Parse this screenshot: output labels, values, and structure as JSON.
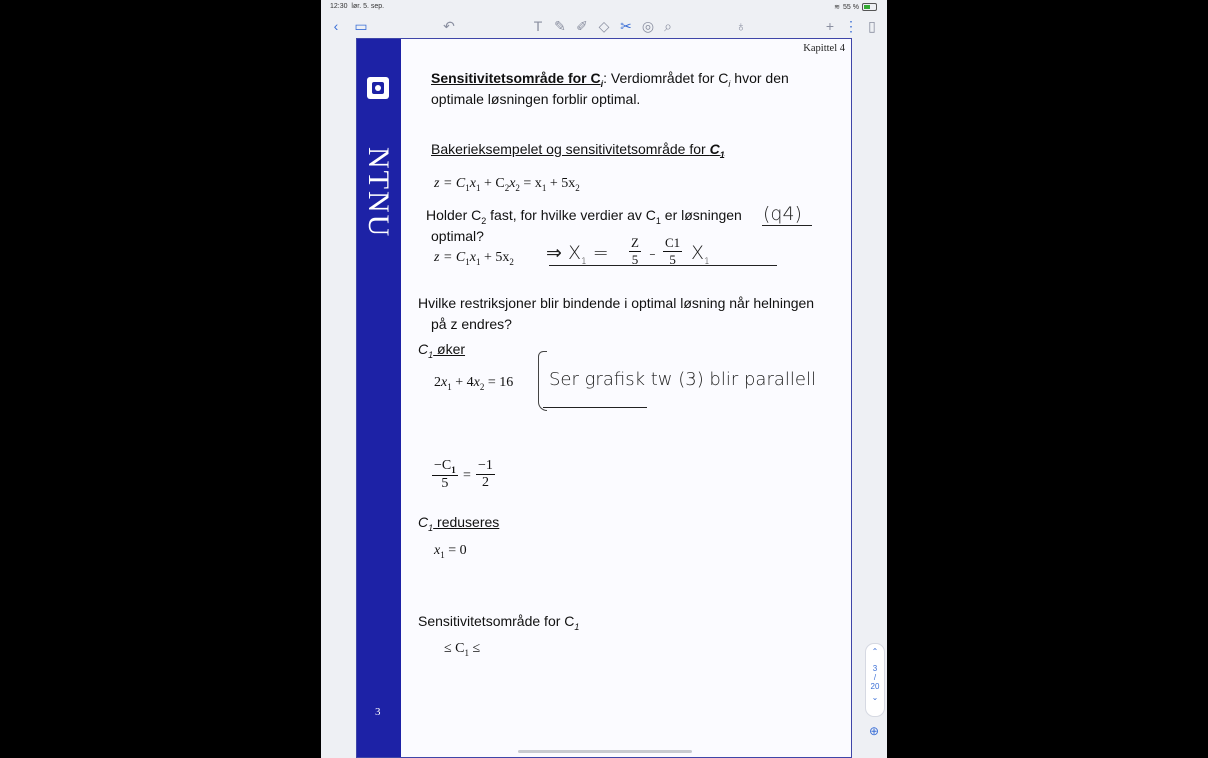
{
  "status": {
    "time": "12:30",
    "date": "lør. 5. sep.",
    "battery": "55 %"
  },
  "toolbar": {
    "icons": [
      "back-icon",
      "thumbnails-icon",
      "undo-icon",
      "text-tool-icon",
      "pen-icon",
      "highlighter-icon",
      "eraser-icon",
      "scissors-icon",
      "shapes-icon",
      "lasso-icon",
      "microphone-icon",
      "add-icon",
      "more-icon",
      "pages-icon"
    ],
    "accent": "#3b6fd6"
  },
  "page": {
    "chapter": "Kapittel 4",
    "number": "3",
    "logo_text": "NTNU",
    "heading1_bold": "Sensitivitetsområde for C",
    "heading1_sub": "i",
    "heading1_rest": ": Verdiområdet for C",
    "heading1_rest_sub": "i",
    "heading1_rest2": " hvor den",
    "heading1_line2": "optimale løsningen forblir optimal.",
    "heading2": "Bakerieksempelet og sensitivitetsområde for ",
    "heading2_bold": "C",
    "heading2_sub": "1",
    "eq1_a": "z = C",
    "eq1_b": "x",
    "eq1_c": " + C",
    "eq1_d": "x",
    "eq1_e": " = x",
    "eq1_f": " + 5x",
    "q1_a": "Holder C",
    "q1_b": " fast, for hvilke verdier av C",
    "q1_c": " er løsningen",
    "q1_line2": "optimal?",
    "eq2_a": "z = C",
    "eq2_b": "x",
    "eq2_c": " + 5x",
    "q2_line1": "Hvilke restriksjoner blir bindende i optimal løsning når helningen",
    "q2_line2": "på z endres?",
    "c1_up_a": "C",
    "c1_up_b": " øker",
    "eq3": "2x",
    "eq3_b": " + 4x",
    "eq3_c": " = 16",
    "frac_left_num": "−C",
    "frac_left_den": "5",
    "frac_eq": "=",
    "frac_right_num": "−1",
    "frac_right_den": "2",
    "c1_down_a": "C",
    "c1_down_b": " reduseres",
    "eq4": "x",
    "eq4_b": " = 0",
    "range_title": "Sensitivitetsområde for C",
    "range_expr_a": "≤ C",
    "range_expr_b": " ≤",
    "sub1": "1",
    "sub2": "2"
  },
  "handwriting": {
    "note1": "(q4)",
    "note2_a": "⇒ X",
    "note2_b": "= ",
    "note2_frac_num": "Z",
    "note2_frac_den": "5",
    "note2_minus": " - ",
    "note2_frac2_num": "C1",
    "note2_frac2_den": "5",
    "note2_tail": "X",
    "note3": "Ser grafisk tw (3) blir parallell"
  },
  "scroller": {
    "current": "3",
    "total": "20"
  }
}
